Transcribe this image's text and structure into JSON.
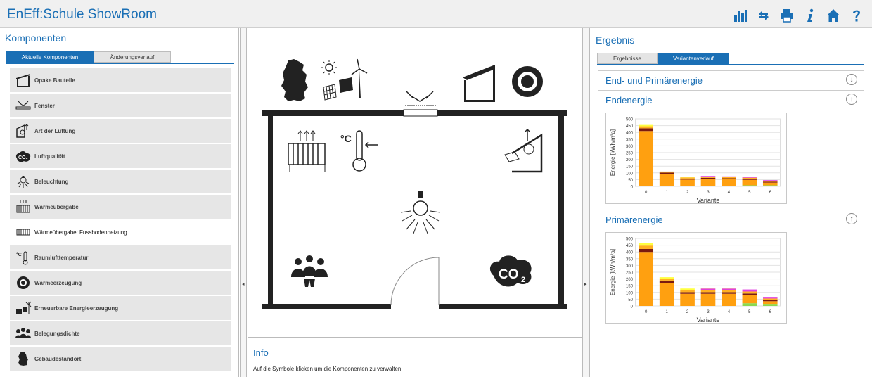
{
  "app": {
    "title": "EnEff:Schule ShowRoom"
  },
  "toolbar": {
    "items": [
      {
        "name": "chart-icon"
      },
      {
        "name": "refresh-icon"
      },
      {
        "name": "print-icon"
      },
      {
        "name": "info-icon"
      },
      {
        "name": "home-icon"
      },
      {
        "name": "help-icon"
      }
    ]
  },
  "left": {
    "title": "Komponenten",
    "tabs": [
      {
        "label": "Aktuelle Komponenten"
      },
      {
        "label": "Änderungsverlauf"
      }
    ],
    "components": [
      {
        "label": "Opake Bauteile",
        "icon": "wall-icon"
      },
      {
        "label": "Fenster",
        "icon": "window-icon"
      },
      {
        "label": "Art der Lüftung",
        "icon": "ventilation-icon"
      },
      {
        "label": "Luftqualität",
        "icon": "co2-icon"
      },
      {
        "label": "Beleuchtung",
        "icon": "lightbulb-icon"
      },
      {
        "label": "Wärmeübergabe",
        "icon": "radiator-icon"
      },
      {
        "label": "Wärmeübergabe: Fussbodenheizung",
        "icon": "radiator-icon"
      },
      {
        "label": "Raumlufttemperatur",
        "icon": "thermometer-icon"
      },
      {
        "label": "Wärmeerzeugung",
        "icon": "heat-generator-icon"
      },
      {
        "label": "Erneuerbare Energieerzeugung",
        "icon": "renewable-icon"
      },
      {
        "label": "Belegungsdichte",
        "icon": "people-icon"
      },
      {
        "label": "Gebäudestandort",
        "icon": "germany-map-icon"
      }
    ]
  },
  "middle": {
    "co2_label": "CO",
    "co2_sub": "2",
    "thermo_label": "°C",
    "info_title": "Info",
    "info_text": "Auf die Symbole klicken um die Komponenten zu verwalten!"
  },
  "right": {
    "title": "Ergebnis",
    "tabs": [
      {
        "label": "Ergebnisse"
      },
      {
        "label": "Variantenverlauf"
      }
    ],
    "accordion_main": "End- und Primärenergie",
    "section_end": "Endenergie",
    "section_primary": "Primärenergie"
  },
  "chart_data": [
    {
      "type": "bar",
      "title": "",
      "xlabel": "Variante",
      "ylabel": "Energie [kWh/m²a]",
      "categories": [
        "0",
        "1",
        "2",
        "3",
        "4",
        "5",
        "6"
      ],
      "ylim": [
        0,
        500
      ],
      "yticks": [
        "0",
        "50",
        "100",
        "150",
        "200",
        "250",
        "300",
        "350",
        "400",
        "450",
        "500"
      ],
      "stacked": true,
      "colors": [
        "#8bd94f",
        "#ffa010",
        "#7a1a10",
        "#ffb020",
        "#e040e0",
        "#ffff40"
      ],
      "series": [
        {
          "values": [
            0,
            0,
            0,
            0,
            0,
            8,
            8
          ]
        },
        {
          "values": [
            410,
            92,
            50,
            55,
            52,
            40,
            20
          ]
        },
        {
          "values": [
            20,
            10,
            8,
            8,
            8,
            8,
            6
          ]
        },
        {
          "values": [
            15,
            8,
            8,
            8,
            8,
            8,
            6
          ]
        },
        {
          "values": [
            0,
            0,
            0,
            6,
            6,
            8,
            6
          ]
        },
        {
          "values": [
            10,
            0,
            6,
            0,
            0,
            0,
            0
          ]
        }
      ]
    },
    {
      "type": "bar",
      "title": "",
      "xlabel": "Variante",
      "ylabel": "Energie [kWh/m²a]",
      "categories": [
        "0",
        "1",
        "2",
        "3",
        "4",
        "5",
        "6"
      ],
      "ylim": [
        0,
        500
      ],
      "yticks": [
        "0",
        "50",
        "100",
        "150",
        "200",
        "250",
        "300",
        "350",
        "400",
        "450",
        "500"
      ],
      "stacked": true,
      "colors": [
        "#8bd94f",
        "#ffa010",
        "#7a1a10",
        "#ffb020",
        "#e040e0",
        "#ffff40"
      ],
      "series": [
        {
          "values": [
            0,
            0,
            0,
            0,
            0,
            20,
            15
          ]
        },
        {
          "values": [
            400,
            170,
            90,
            90,
            90,
            60,
            20
          ]
        },
        {
          "values": [
            22,
            18,
            12,
            12,
            12,
            12,
            8
          ]
        },
        {
          "values": [
            25,
            15,
            15,
            15,
            15,
            15,
            12
          ]
        },
        {
          "values": [
            0,
            0,
            0,
            12,
            12,
            15,
            12
          ]
        },
        {
          "values": [
            20,
            10,
            12,
            6,
            6,
            0,
            0
          ]
        }
      ]
    }
  ]
}
